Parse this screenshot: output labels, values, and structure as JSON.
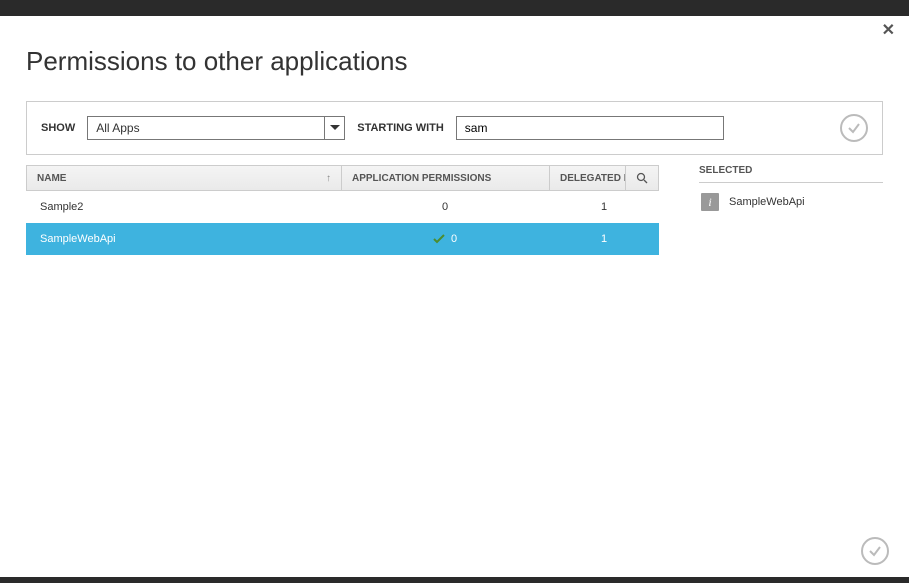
{
  "title": "Permissions to other applications",
  "filter": {
    "show_label": "SHOW",
    "show_value": "All Apps",
    "starting_label": "STARTING WITH",
    "starting_value": "sam"
  },
  "columns": {
    "name": "NAME",
    "app_permissions": "APPLICATION PERMISSIONS",
    "delegated_permissions": "DELEGATED P..."
  },
  "rows": [
    {
      "name": "Sample2",
      "app_permissions": "0",
      "delegated_permissions": "1",
      "selected": false,
      "checked": false
    },
    {
      "name": "SampleWebApi",
      "app_permissions": "0",
      "delegated_permissions": "1",
      "selected": true,
      "checked": true
    }
  ],
  "selected_panel": {
    "header": "SELECTED",
    "items": [
      {
        "name": "SampleWebApi"
      }
    ]
  }
}
